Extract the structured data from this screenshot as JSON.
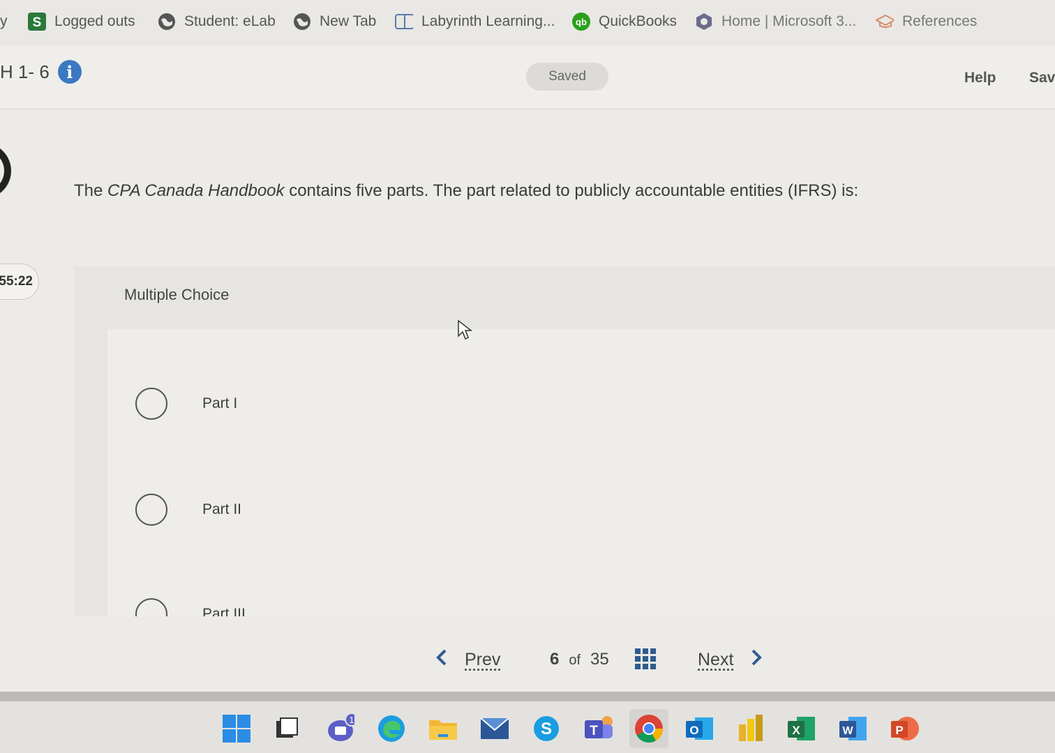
{
  "bookmarks": [
    {
      "label": "y",
      "icon": "none"
    },
    {
      "label": "Logged outs",
      "icon": "s-app-icon"
    },
    {
      "label": "Student: eLab",
      "icon": "globe-icon"
    },
    {
      "label": "New Tab",
      "icon": "globe-icon"
    },
    {
      "label": "Labyrinth Learning...",
      "icon": "book-icon"
    },
    {
      "label": "QuickBooks",
      "icon": "quickbooks-icon"
    },
    {
      "label": "Home | Microsoft 3...",
      "icon": "microsoft365-icon"
    },
    {
      "label": "References",
      "icon": "graduation-cap-icon"
    }
  ],
  "header": {
    "title": "H 1- 6",
    "saved": "Saved",
    "help": "Help",
    "save": "Sav"
  },
  "question": {
    "text_before": "The ",
    "text_italic": "CPA Canada Handbook",
    "text_after": " contains five parts. The part related to publicly accountable entities (IFRS) is:"
  },
  "timer": "55:22",
  "answer": {
    "type_label": "Multiple Choice",
    "options": [
      "Part I",
      "Part II",
      "Part III"
    ]
  },
  "nav": {
    "prev": "Prev",
    "current": "6",
    "of": "of",
    "total": "35",
    "next": "Next"
  },
  "taskbar": {
    "teams_badge": "1",
    "icons": [
      "windows-start-icon",
      "task-view-icon",
      "teams-chat-icon",
      "edge-icon",
      "file-explorer-icon",
      "mail-icon",
      "skype-icon",
      "teams-icon",
      "chrome-icon",
      "outlook-icon",
      "power-bi-icon",
      "excel-icon",
      "word-icon",
      "powerpoint-icon"
    ]
  },
  "colors": {
    "info": "#3b79c2",
    "excel": "#1e7145",
    "word": "#2b5797",
    "powerpoint": "#d24726",
    "chrome_red": "#db4437",
    "quickbooks": "#2ca01c"
  }
}
